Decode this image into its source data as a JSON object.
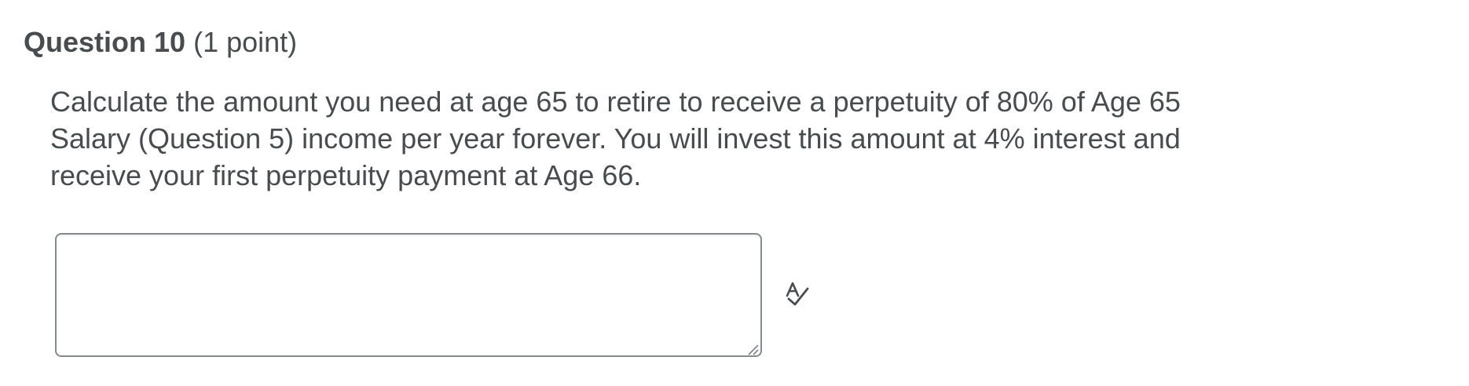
{
  "question": {
    "number_label": "Question 10",
    "points_label": "(1 point)",
    "body_text": "Calculate the amount you need at age 65 to retire to receive a perpetuity of 80% of Age 65 Salary (Question 5) income per year forever. You will invest this amount at 4% interest and receive your first perpetuity payment at Age 66."
  },
  "answer": {
    "value": "",
    "placeholder": ""
  },
  "icons": {
    "spellcheck": "spellcheck-icon",
    "resize": "resize-grip-icon"
  },
  "colors": {
    "text": "#494c4e",
    "border": "#878a8c"
  }
}
